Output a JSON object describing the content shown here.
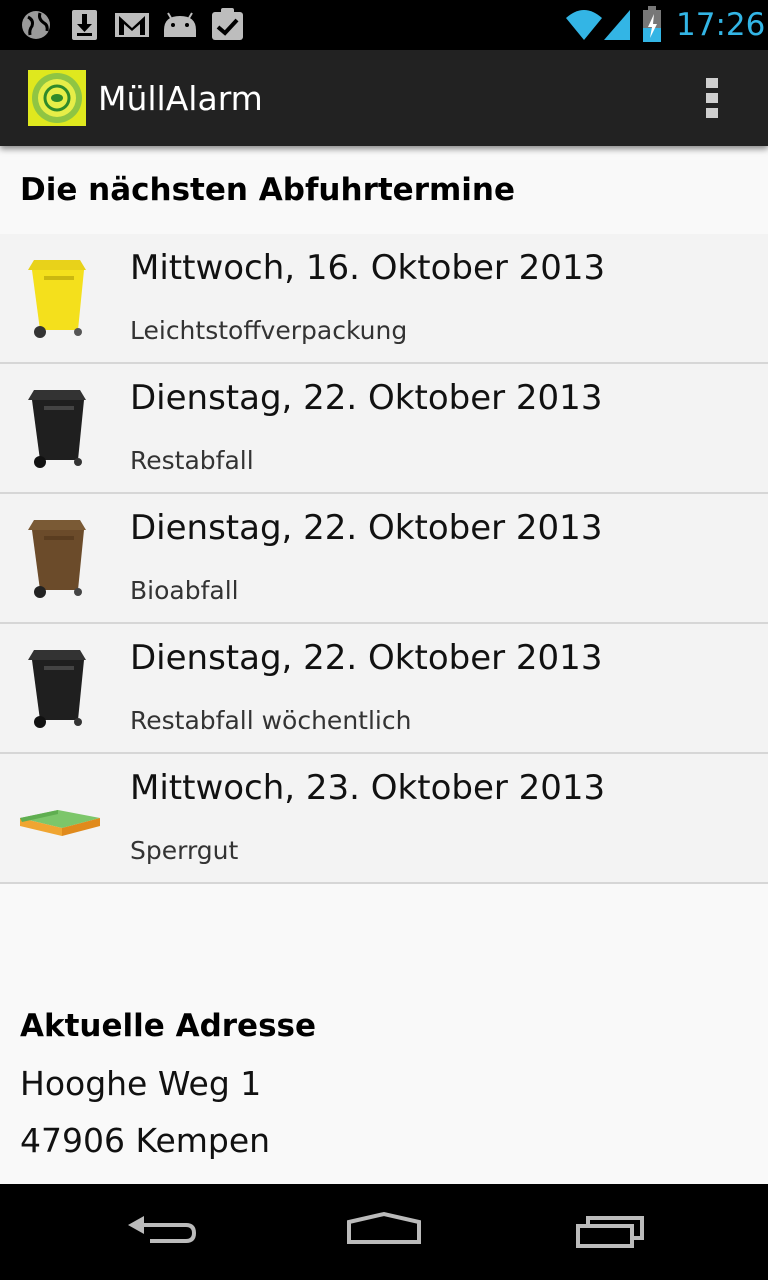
{
  "status_bar": {
    "time": "17:26",
    "notification_icons": [
      "globe-icon",
      "download-icon",
      "gmail-icon",
      "android-icon",
      "clipboard-check-icon"
    ],
    "system_icons": [
      "wifi-icon",
      "signal-icon",
      "battery-charging-icon"
    ]
  },
  "action_bar": {
    "app_title": "MüllAlarm",
    "app_icon": "muellalarm-logo-icon",
    "overflow_icon": "overflow-menu-icon"
  },
  "main": {
    "section_title": "Die nächsten Abfuhrtermine",
    "appointments": [
      {
        "date": "Mittwoch, 16. Oktober 2013",
        "type": "Leichtstoffverpackung",
        "icon": "yellow-bin-icon"
      },
      {
        "date": "Dienstag, 22. Oktober 2013",
        "type": "Restabfall",
        "icon": "black-bin-icon"
      },
      {
        "date": "Dienstag, 22. Oktober 2013",
        "type": "Bioabfall",
        "icon": "brown-bin-icon"
      },
      {
        "date": "Dienstag, 22. Oktober 2013",
        "type": "Restabfall wöchentlich",
        "icon": "black-bin-icon"
      },
      {
        "date": "Mittwoch, 23. Oktober 2013",
        "type": "Sperrgut",
        "icon": "bulky-waste-bed-icon"
      }
    ],
    "address": {
      "title": "Aktuelle Adresse",
      "street": "Hooghe Weg 1",
      "city": "47906 Kempen"
    }
  },
  "nav_bar": {
    "icons": [
      "back-icon",
      "home-icon",
      "recent-apps-icon"
    ]
  },
  "colors": {
    "accent": "#33b5e5",
    "action_bar": "#222222",
    "yellow_bin": "#f4e01c",
    "black_bin": "#1f1f1f",
    "brown_bin": "#6b4b2a"
  }
}
